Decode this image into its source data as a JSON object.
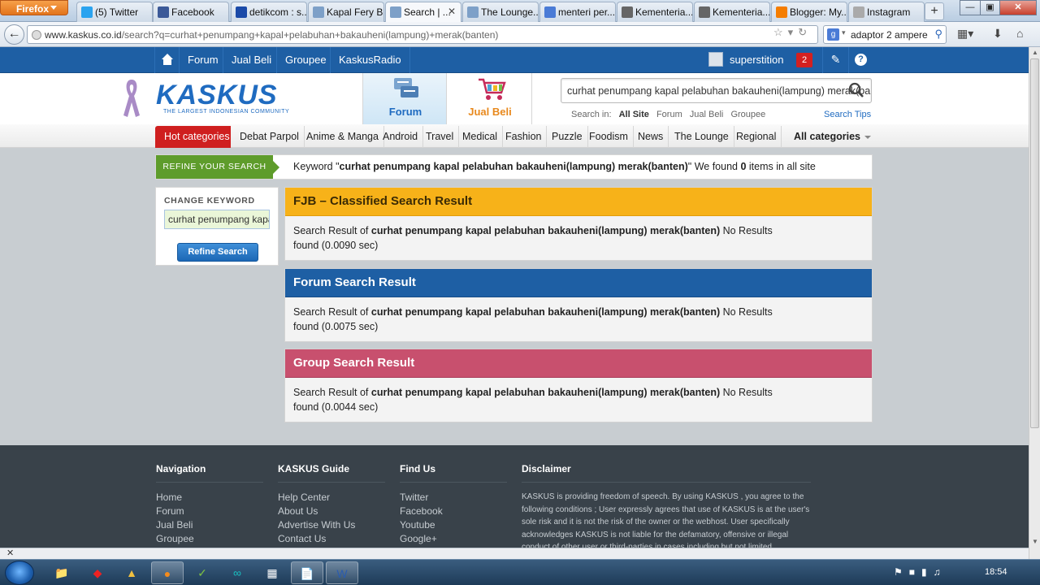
{
  "browser": {
    "app_button": "Firefox",
    "tabs": [
      {
        "label": "(5) Twitter",
        "icon": "twitter-icon",
        "color": "#2aa3ef"
      },
      {
        "label": "Facebook",
        "icon": "facebook-icon",
        "color": "#3b5998"
      },
      {
        "label": "detikcom : s...",
        "icon": "detik-icon",
        "color": "#1b4aa8"
      },
      {
        "label": "Kapal Fery B...",
        "icon": "kaskus-icon",
        "color": "#7da0c8"
      },
      {
        "label": "Search | ...",
        "icon": "kaskus-icon",
        "color": "#7da0c8",
        "active": true
      },
      {
        "label": "The Lounge...",
        "icon": "kaskus-icon",
        "color": "#7da0c8"
      },
      {
        "label": "menteri per...",
        "icon": "google-icon",
        "color": "#4a7bd6"
      },
      {
        "label": "Kementeria...",
        "icon": "wikipedia-icon",
        "color": "#666666"
      },
      {
        "label": "Kementeria...",
        "icon": "wikipedia-icon",
        "color": "#666666"
      },
      {
        "label": "Blogger: My...",
        "icon": "blogger-icon",
        "color": "#f57d00"
      },
      {
        "label": "Instagram",
        "icon": "instagram-icon",
        "color": "#aaaaaa"
      }
    ],
    "new_tab": "+",
    "url_domain": "www.kaskus.co.id",
    "url_rest": "/search?q=curhat+penumpang+kapal+pelabuhan+bakauheni(lampung)+merak(banten)",
    "search_value": "adaptor 2 ampere",
    "search_engine_letter": "g"
  },
  "kaskus": {
    "topnav": [
      "Forum",
      "Jual Beli",
      "Groupee",
      "KaskusRadio"
    ],
    "username": "superstition",
    "notif_count": "2",
    "logo_text": "KASKUS",
    "logo_tagline": "THE LARGEST INDONESIAN COMMUNITY",
    "tab_forum": "Forum",
    "tab_jualbeli": "Jual Beli",
    "search_value": "curhat penumpang kapal pelabuhan bakauheni(lampung) merak(banten)",
    "search_in_label": "Search in:",
    "search_in": [
      "All Site",
      "Forum",
      "Jual Beli",
      "Groupee"
    ],
    "search_tips": "Search Tips",
    "hot_label": "Hot categories",
    "categories": [
      "Debat Parpol",
      "Anime & Manga",
      "Android",
      "Travel",
      "Medical",
      "Fashion",
      "Puzzle",
      "Foodism",
      "News",
      "The Lounge",
      "Regional"
    ],
    "all_categories": "All categories"
  },
  "results": {
    "refine_label": "REFINE YOUR SEARCH",
    "keyword_prefix": "Keyword \"",
    "keyword": "curhat penumpang kapal pelabuhan bakauheni(lampung) merak(banten)",
    "keyword_mid": "\" We found ",
    "found_count": "0",
    "keyword_suffix": " items in all site",
    "change_keyword": "CHANGE KEYWORD",
    "input_value": "curhat penumpang kapal pelabuhan bakauheni(lampung) merak(banten)",
    "refine_button": "Refine Search",
    "sections": [
      {
        "title": "FJB – Classified Search Result",
        "prefix": "Search Result of ",
        "query": "curhat penumpang kapal pelabuhan bakauheni(lampung) merak(banten)",
        "suffix": "  No Results found (0.0090 sec)"
      },
      {
        "title": "Forum Search Result",
        "prefix": "Search Result of ",
        "query": "curhat penumpang kapal pelabuhan bakauheni(lampung) merak(banten)",
        "suffix": " No Results found (0.0075 sec)"
      },
      {
        "title": "Group Search Result",
        "prefix": "Search Result of ",
        "query": "curhat penumpang kapal pelabuhan bakauheni(lampung) merak(banten)",
        "suffix": " No Results found (0.0044 sec)"
      }
    ]
  },
  "footer": {
    "navigation": {
      "title": "Navigation",
      "links": [
        "Home",
        "Forum",
        "Jual Beli",
        "Groupee"
      ]
    },
    "guide": {
      "title": "KASKUS Guide",
      "links": [
        "Help Center",
        "About Us",
        "Advertise With Us",
        "Contact Us"
      ]
    },
    "findus": {
      "title": "Find Us",
      "links": [
        "Twitter",
        "Facebook",
        "Youtube",
        "Google+"
      ]
    },
    "disclaimer": {
      "title": "Disclaimer",
      "text": "KASKUS is providing freedom of speech. By using KASKUS , you agree to the following conditions ; User expressly agrees that use of KASKUS is at the user's sole risk and it is not the risk of the owner or the webhost. User specifically acknowledges KASKUS is not liable for the defamatory, offensive or illegal conduct of other user or third-parties in cases including but not limited"
    }
  },
  "taskbar": {
    "clock": "18:54"
  }
}
